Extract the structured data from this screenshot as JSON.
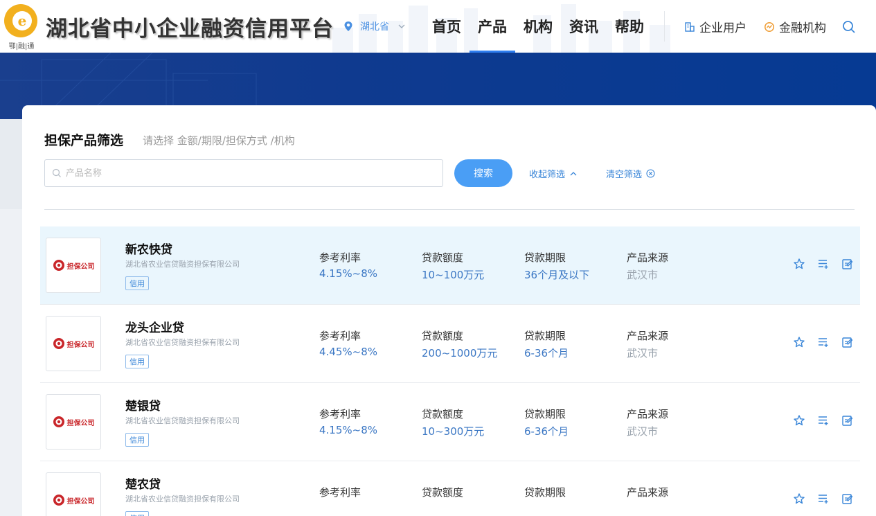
{
  "header": {
    "logo_sub": "鄂|融|通",
    "site_title": "湖北省中小企业融资信用平台",
    "region": "湖北省",
    "nav": [
      "首页",
      "产品",
      "机构",
      "资讯",
      "帮助"
    ],
    "active_nav": "产品",
    "enterprise_user": "企业用户",
    "financial_institution": "金融机构"
  },
  "filter": {
    "title": "担保产品筛选",
    "hint": "请选择 金额/期限/担保方式 /机构",
    "search_placeholder": "产品名称",
    "search_button": "搜索",
    "collapse": "收起筛选",
    "clear": "清空筛选"
  },
  "labels": {
    "rate": "参考利率",
    "amount": "贷款额度",
    "term": "贷款期限",
    "source": "产品来源",
    "logo_text": "担保公司"
  },
  "products": [
    {
      "name": "新农快贷",
      "org": "湖北省农业信贷融资担保有限公司",
      "tag": "信用",
      "rate": "4.15%~8%",
      "amount": "10~100万元",
      "term": "36个月及以下",
      "source": "武汉市"
    },
    {
      "name": "龙头企业贷",
      "org": "湖北省农业信贷融资担保有限公司",
      "tag": "信用",
      "rate": "4.45%~8%",
      "amount": "200~1000万元",
      "term": "6-36个月",
      "source": "武汉市"
    },
    {
      "name": "楚银贷",
      "org": "湖北省农业信贷融资担保有限公司",
      "tag": "信用",
      "rate": "4.15%~8%",
      "amount": "10~300万元",
      "term": "6-36个月",
      "source": "武汉市"
    },
    {
      "name": "楚农贷",
      "org": "湖北省农业信贷融资担保有限公司",
      "tag": "信用",
      "rate": "",
      "amount": "",
      "term": "",
      "source": ""
    }
  ],
  "colors": {
    "accent": "#2f7ef0",
    "button": "#4a9ef5",
    "banner": "#0f3a8f",
    "highlight_row": "#eaf6fd",
    "value_blue": "#3b77c4"
  },
  "icons": [
    "location-pin-icon",
    "chevron-down-icon",
    "building-icon",
    "institution-icon",
    "search-icon",
    "chevron-up-icon",
    "clear-circle-icon",
    "star-icon",
    "list-add-icon",
    "edit-icon"
  ]
}
